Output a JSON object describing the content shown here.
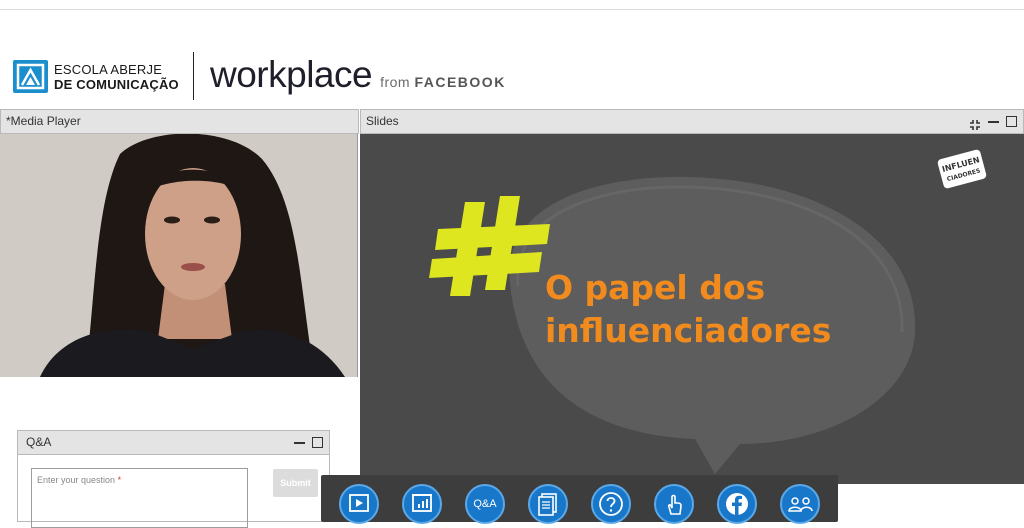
{
  "header": {
    "aberje_line1": "ESCOLA ABERJE",
    "aberje_line2": "DE COMUNICAÇÃO",
    "workplace_word": "workplace",
    "workplace_from": "from",
    "workplace_brand": "FACEBOOK"
  },
  "panels": {
    "media_player_title": "*Media Player",
    "slides_title": "Slides"
  },
  "slide": {
    "hashtag": "#",
    "title_line1": "O papel dos",
    "title_line2": "influenciadores",
    "stamp_line1": "INFLUEN",
    "stamp_line2": "CIADORES",
    "colors": {
      "background": "#4a4a4a",
      "bubble": "#5b5b5b",
      "hashtag": "#dde61f",
      "title": "#f28b1e"
    }
  },
  "qa": {
    "title": "Q&A",
    "input_placeholder": "Enter your question",
    "required_mark": "*",
    "submit_label": "Submit"
  },
  "toolbar": {
    "qa_label": "Q&A",
    "buttons": [
      "media-player",
      "slides",
      "qa",
      "resources",
      "help",
      "interact",
      "facebook",
      "people"
    ],
    "accent_color": "#1877c9"
  }
}
